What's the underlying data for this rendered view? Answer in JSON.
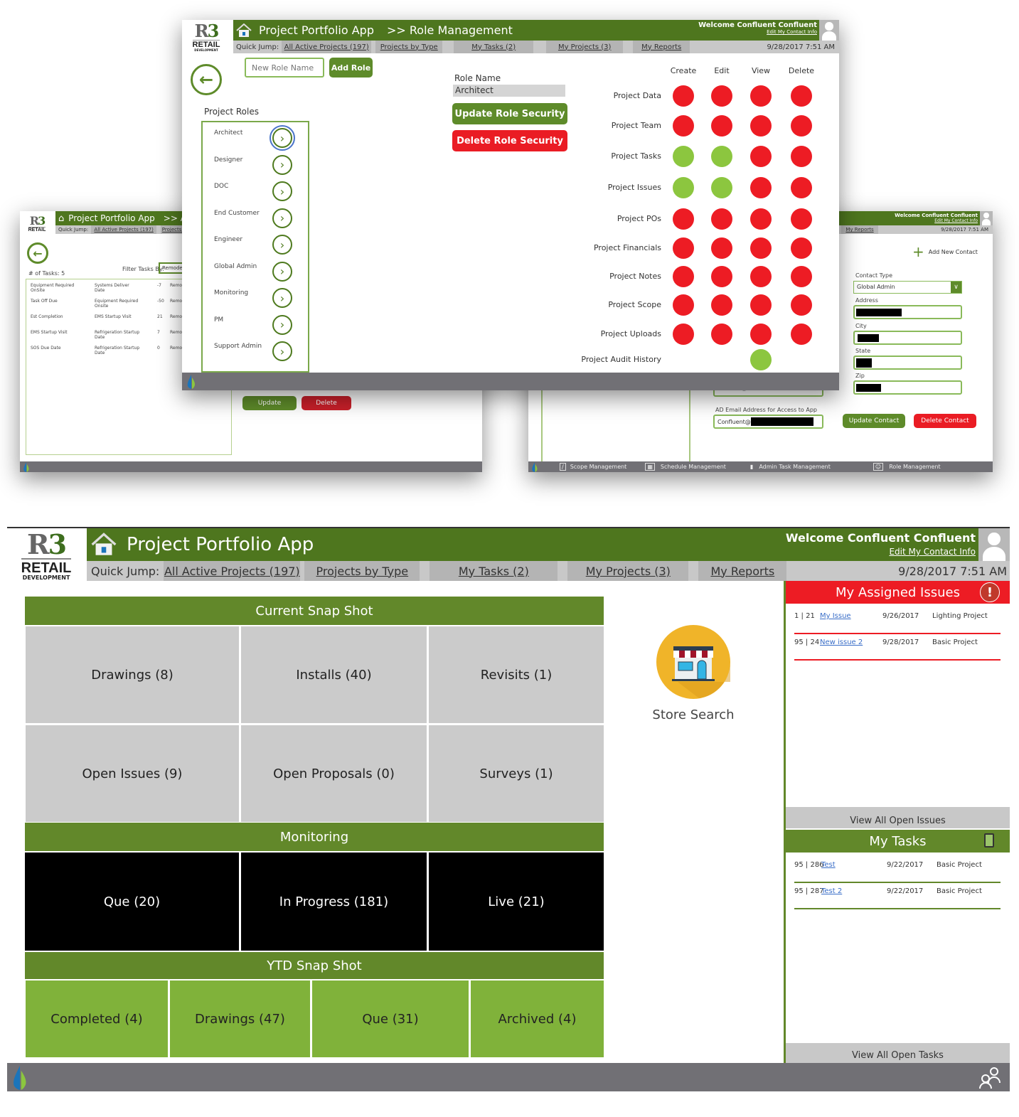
{
  "app": {
    "title": "Project Portfolio App",
    "logo_main": "R",
    "logo_num": "3",
    "logo_retail": "RETAIL",
    "logo_development": "DEVELOPMENT",
    "welcome": "Welcome Confluent Confluent",
    "edit_contact": "Edit My Contact Info",
    "datetime": "9/28/2017 7:51 AM",
    "quick_jump_label": "Quick Jump:",
    "quick_jump": [
      "All Active Projects (197)",
      "Projects by Type",
      "My Tasks (2)",
      "My Projects (3)",
      "My Reports"
    ]
  },
  "role_window": {
    "breadcrumb": ">> Role Management",
    "new_role_placeholder": "New Role Name",
    "add_role": "Add Role",
    "roles_heading": "Project Roles",
    "roles": [
      "Architect",
      "Designer",
      "DOC",
      "End Customer",
      "Engineer",
      "Global Admin",
      "Monitoring",
      "PM",
      "Support Admin"
    ],
    "role_name_label": "Role Name",
    "role_name_value": "Architect",
    "update_role": "Update Role Security",
    "delete_role": "Delete Role Security",
    "permission_columns": [
      "Create",
      "Edit",
      "View",
      "Delete"
    ],
    "permissions": [
      {
        "name": "Project Data",
        "values": [
          "deny",
          "deny",
          "deny",
          "deny"
        ]
      },
      {
        "name": "Project Team",
        "values": [
          "deny",
          "deny",
          "deny",
          "deny"
        ]
      },
      {
        "name": "Project Tasks",
        "values": [
          "allow",
          "allow",
          "deny",
          "deny"
        ]
      },
      {
        "name": "Project Issues",
        "values": [
          "allow",
          "allow",
          "deny",
          "deny"
        ]
      },
      {
        "name": "Project POs",
        "values": [
          "deny",
          "deny",
          "deny",
          "deny"
        ]
      },
      {
        "name": "Project Financials",
        "values": [
          "deny",
          "deny",
          "deny",
          "deny"
        ]
      },
      {
        "name": "Project Notes",
        "values": [
          "deny",
          "deny",
          "deny",
          "deny"
        ]
      },
      {
        "name": "Project Scope",
        "values": [
          "deny",
          "deny",
          "deny",
          "deny"
        ]
      },
      {
        "name": "Project Uploads",
        "values": [
          "deny",
          "deny",
          "deny",
          "deny"
        ]
      },
      {
        "name": "Project Audit History",
        "values": [
          "none",
          "none",
          "allow",
          "none"
        ]
      }
    ],
    "colors": {
      "allow": "#8cc63f",
      "deny": "#ed1c24"
    }
  },
  "task_window": {
    "breadcrumb": ">> Ad",
    "task_count": "# of Tasks: 5",
    "filter_label": "Filter Tasks By:",
    "filter_value": "Remodel",
    "rows": [
      {
        "task": "Equipment Required OnSite",
        "relative": "Systems Deliver Date",
        "days": "-7",
        "type": "Remo"
      },
      {
        "task": "Task Off Due",
        "relative": "Equipment Required Onsite",
        "days": "-50",
        "type": "Remo"
      },
      {
        "task": "Est Completion",
        "relative": "EMS Startup Visit",
        "days": "21",
        "type": "Remo"
      },
      {
        "task": "EMS Startup Visit",
        "relative": "Refrigeration Startup Date",
        "days": "7",
        "type": "Remo"
      },
      {
        "task": "SOS Due Date",
        "relative": "Refrigeration Startup Date",
        "days": "0",
        "type": "Remo"
      }
    ],
    "update": "Update",
    "delete": "Delete"
  },
  "contact_window": {
    "add_contact": "Add New Contact",
    "contact_type_label": "Contact Type",
    "contact_type_value": "Global Admin",
    "address_label": "Address",
    "city_label": "City",
    "state_label": "State",
    "zip_label": "Zip",
    "email_partial": "Confluent@r3retailsolutions.com",
    "ad_email_label": "AD Email Address for Access to App",
    "ad_email_value": "Confluent@",
    "update_contact": "Update Contact",
    "delete_contact": "Delete Contact",
    "footer_nav": [
      "Scope Management",
      "Schedule Management",
      "Admin Task Management",
      "Role Management"
    ]
  },
  "dashboard": {
    "current_snapshot": {
      "title": "Current Snap Shot",
      "tiles": [
        "Drawings (8)",
        "Installs (40)",
        "Revisits (1)",
        "Open Issues (9)",
        "Open Proposals (0)",
        "Surveys (1)"
      ]
    },
    "monitoring": {
      "title": "Monitoring",
      "tiles": [
        "Que (20)",
        "In Progress (181)",
        "Live (21)"
      ]
    },
    "ytd_snapshot": {
      "title": "YTD Snap Shot",
      "tiles": [
        "Completed (4)",
        "Drawings (47)",
        "Que (31)",
        "Archived (4)"
      ]
    },
    "store_search": "Store Search",
    "issues": {
      "title": "My Assigned Issues",
      "items": [
        {
          "id": "1 | 21",
          "link": "My Issue",
          "date": "9/26/2017",
          "project": "Lighting Project"
        },
        {
          "id": "95 | 24",
          "link": "New issue 2",
          "date": "9/28/2017",
          "project": "Basic Project"
        }
      ],
      "view_all": "View All Open Issues"
    },
    "tasks": {
      "title": "My Tasks",
      "items": [
        {
          "id": "95 | 286",
          "link": "Test",
          "date": "9/22/2017",
          "project": "Basic Project"
        },
        {
          "id": "95 | 287",
          "link": "Test 2",
          "date": "9/22/2017",
          "project": "Basic Project"
        }
      ],
      "view_all": "View All Open Tasks"
    }
  }
}
